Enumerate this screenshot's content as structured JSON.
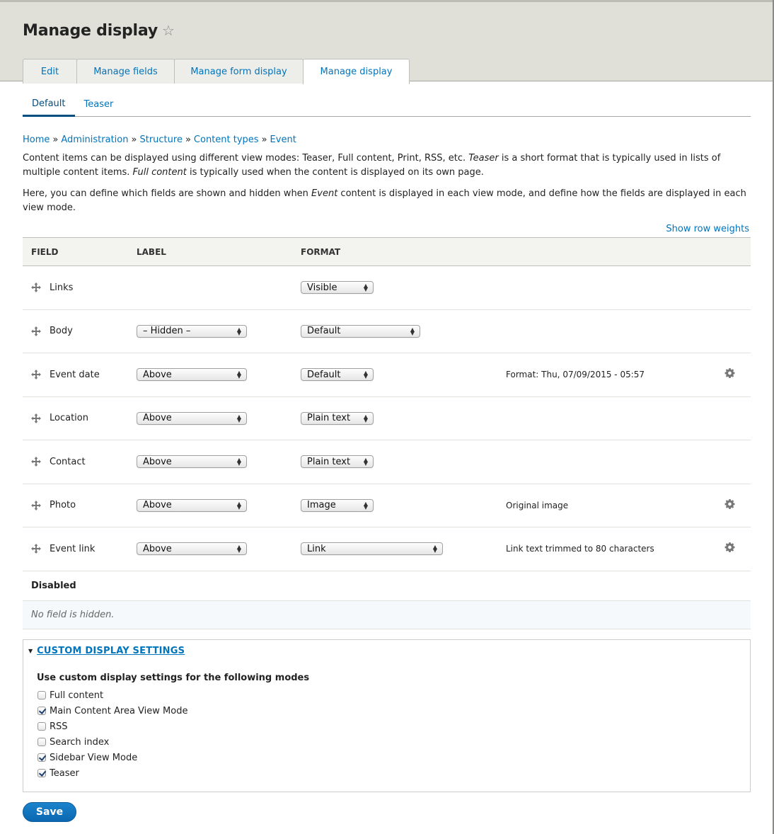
{
  "header": {
    "title": "Manage display",
    "star_icon": "star-outline-icon",
    "tabs": [
      {
        "label": "Edit",
        "active": false
      },
      {
        "label": "Manage fields",
        "active": false
      },
      {
        "label": "Manage form display",
        "active": false
      },
      {
        "label": "Manage display",
        "active": true
      }
    ]
  },
  "subtabs": [
    {
      "label": "Default",
      "active": true
    },
    {
      "label": "Teaser",
      "active": false
    }
  ],
  "breadcrumb": {
    "items": [
      "Home",
      "Administration",
      "Structure",
      "Content types",
      "Event"
    ],
    "separator": "»"
  },
  "description": {
    "p1_a": "Content items can be displayed using different view modes: Teaser, Full content, Print, RSS, etc. ",
    "p1_em1": "Teaser",
    "p1_b": " is a short format that is typically used in lists of multiple content items. ",
    "p1_em2": "Full content",
    "p1_c": " is typically used when the content is displayed on its own page.",
    "p2_a": "Here, you can define which fields are shown and hidden when ",
    "p2_em": "Event",
    "p2_b": " content is displayed in each view mode, and define how the fields are displayed in each view mode."
  },
  "show_row_weights": "Show row weights",
  "table": {
    "headers": {
      "field": "FIELD",
      "label": "LABEL",
      "format": "FORMAT"
    },
    "rows": [
      {
        "field": "Links",
        "label": null,
        "format": "Visible",
        "summary": "",
        "has_settings": false
      },
      {
        "field": "Body",
        "label": "– Hidden –",
        "format": "Default",
        "summary": "",
        "has_settings": false
      },
      {
        "field": "Event date",
        "label": "Above",
        "format": "Default",
        "summary": "Format: Thu, 07/09/2015 - 05:57",
        "has_settings": true
      },
      {
        "field": "Location",
        "label": "Above",
        "format": "Plain text",
        "summary": "",
        "has_settings": false
      },
      {
        "field": "Contact",
        "label": "Above",
        "format": "Plain text",
        "summary": "",
        "has_settings": false
      },
      {
        "field": "Photo",
        "label": "Above",
        "format": "Image",
        "summary": "Original image",
        "has_settings": true
      },
      {
        "field": "Event link",
        "label": "Above",
        "format": "Link",
        "summary": "Link text trimmed to 80 characters",
        "has_settings": true
      }
    ],
    "disabled_label": "Disabled",
    "disabled_empty": "No field is hidden."
  },
  "custom_display": {
    "summary": "CUSTOM DISPLAY SETTINGS",
    "title": "Use custom display settings for the following modes",
    "modes": [
      {
        "label": "Full content",
        "checked": false
      },
      {
        "label": "Main Content Area View Mode",
        "checked": true
      },
      {
        "label": "RSS",
        "checked": false
      },
      {
        "label": "Search index",
        "checked": false
      },
      {
        "label": "Sidebar View Mode",
        "checked": true
      },
      {
        "label": "Teaser",
        "checked": true
      }
    ]
  },
  "save_label": "Save"
}
